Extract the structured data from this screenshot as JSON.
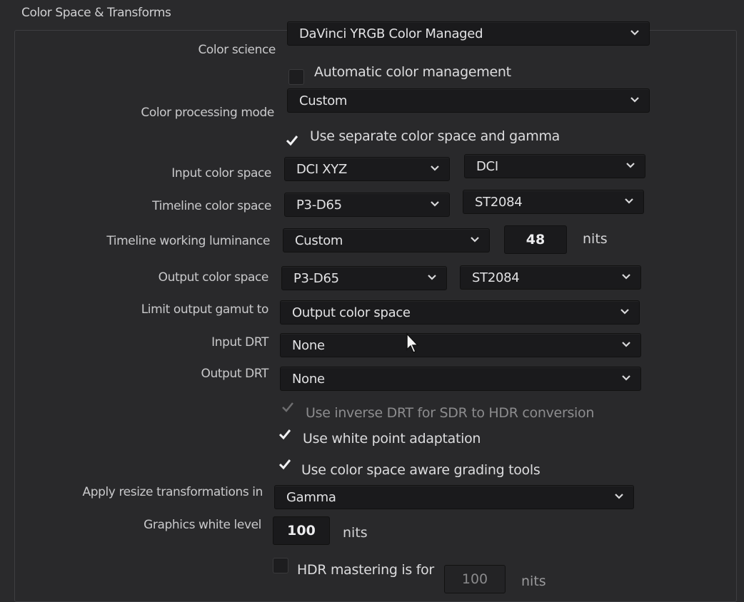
{
  "section": {
    "title": "Color Space & Transforms"
  },
  "fields": {
    "color_science": {
      "label": "Color science",
      "value": "DaVinci YRGB Color Managed"
    },
    "automatic_color_management": {
      "label": "Automatic color management",
      "checked": false
    },
    "color_processing_mode": {
      "label": "Color processing mode",
      "value": "Custom"
    },
    "use_separate": {
      "label": "Use separate color space and gamma",
      "checked": true
    },
    "input_color_space": {
      "label": "Input color space",
      "space": "DCI XYZ",
      "gamma": "DCI"
    },
    "timeline_color_space": {
      "label": "Timeline color space",
      "space": "P3-D65",
      "gamma": "ST2084"
    },
    "timeline_working_luminance": {
      "label": "Timeline working luminance",
      "value": "Custom",
      "nits_value": "48",
      "unit": "nits"
    },
    "output_color_space": {
      "label": "Output color space",
      "space": "P3-D65",
      "gamma": "ST2084"
    },
    "limit_output_gamut": {
      "label": "Limit output gamut to",
      "value": "Output color space"
    },
    "input_drt": {
      "label": "Input DRT",
      "value": "None"
    },
    "output_drt": {
      "label": "Output DRT",
      "value": "None"
    },
    "use_inverse_drt": {
      "label": "Use inverse DRT for SDR to HDR conversion",
      "checked": true,
      "disabled": true
    },
    "white_point_adaptation": {
      "label": "Use white point adaptation",
      "checked": true
    },
    "color_space_aware": {
      "label": "Use color space aware grading tools",
      "checked": true
    },
    "apply_resize": {
      "label": "Apply resize transformations in",
      "value": "Gamma"
    },
    "graphics_white_level": {
      "label": "Graphics white level",
      "value": "100",
      "unit": "nits"
    },
    "hdr_mastering": {
      "label": "HDR mastering is for",
      "checked": false,
      "value": "100",
      "unit": "nits"
    }
  },
  "icons": {
    "dropdown": "chevron-down-icon",
    "check": "checkmark-icon",
    "pointer": "mouse-cursor-icon"
  }
}
